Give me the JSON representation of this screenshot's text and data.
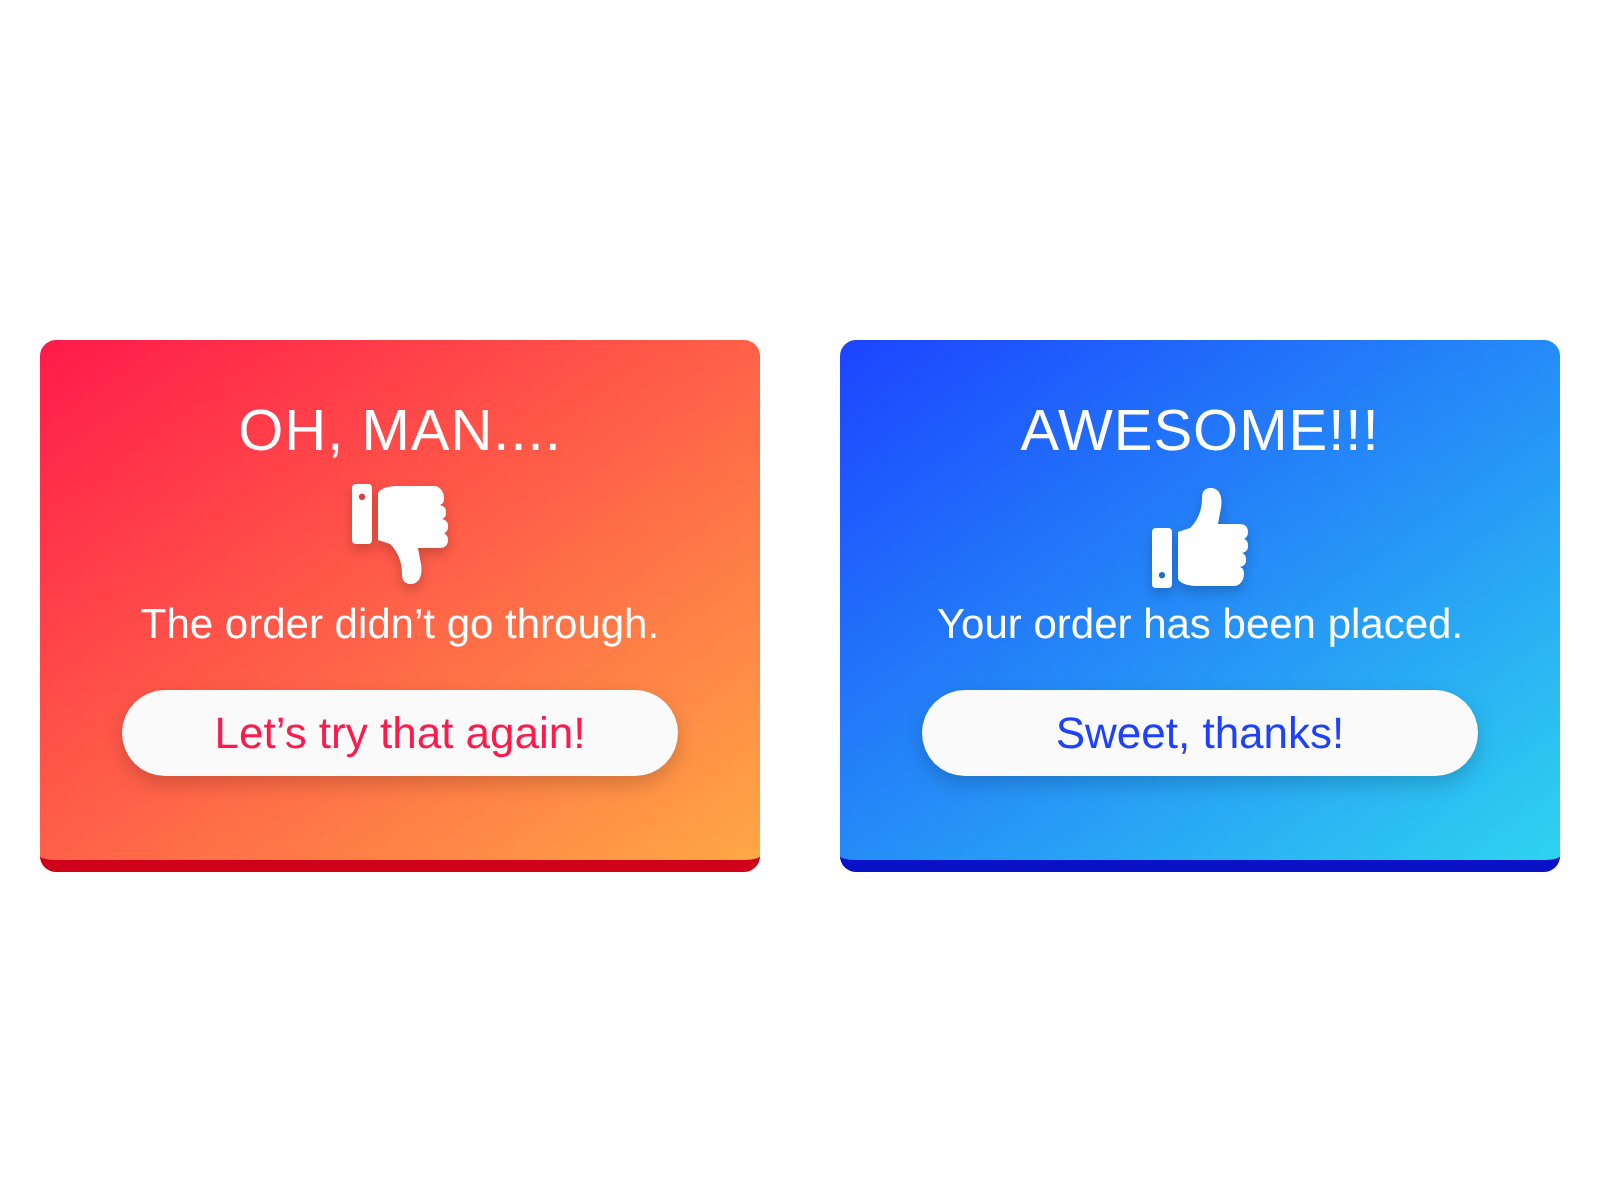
{
  "cards": [
    {
      "kind": "error",
      "title": "OH, MAN....",
      "message": "The order didn’t go through.",
      "button": "Let’s try that again!"
    },
    {
      "kind": "success",
      "title": "AWESOME!!!",
      "message": "Your order has been placed.",
      "button": "Sweet, thanks!"
    }
  ]
}
